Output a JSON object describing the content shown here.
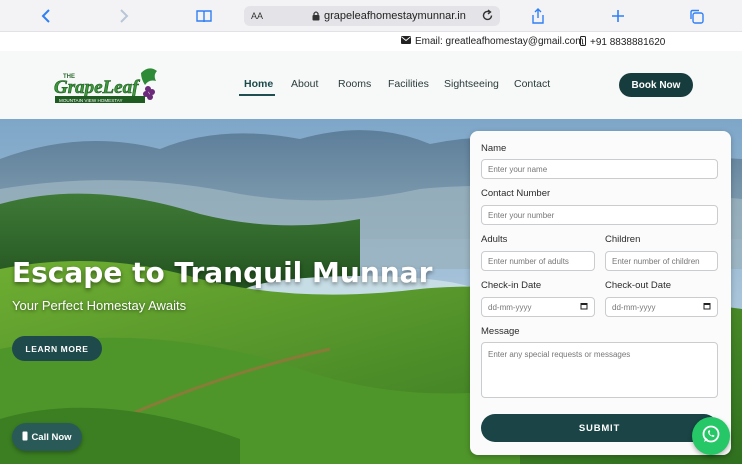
{
  "browser": {
    "url": "grapeleafhomestaymunnar.in",
    "aa_label": "AA",
    "icons": [
      "back-icon",
      "forward-icon",
      "bookmarks-icon",
      "lock-icon",
      "reload-icon",
      "share-icon",
      "new-tab-icon",
      "tabs-icon"
    ]
  },
  "topbar": {
    "email": "Email: greatleafhomestay@gmail.com",
    "phone": "+91 8838881620"
  },
  "logo": {
    "prefix": "THE",
    "name": "GrapeLeaf",
    "tagline": "MOUNTAIN VIEW HOMESTAY"
  },
  "nav": {
    "items": [
      "Home",
      "About",
      "Rooms",
      "Facilities",
      "Sightseeing",
      "Contact"
    ],
    "active": "Home",
    "book_label": "Book Now"
  },
  "hero": {
    "title": "Escape to Tranquil Munnar",
    "subtitle": "Your Perfect Homestay Awaits",
    "learn_more": "LEARN MORE",
    "call_now": "Call Now"
  },
  "form": {
    "name_label": "Name",
    "name_placeholder": "Enter your name",
    "contact_label": "Contact Number",
    "contact_placeholder": "Enter your number",
    "adults_label": "Adults",
    "adults_placeholder": "Enter number of adults",
    "children_label": "Children",
    "children_placeholder": "Enter number of children",
    "checkin_label": "Check-in Date",
    "checkin_placeholder": "dd-mm-yyyy",
    "checkout_label": "Check-out Date",
    "checkout_placeholder": "dd-mm-yyyy",
    "message_label": "Message",
    "message_placeholder": "Enter any special requests or messages",
    "submit_label": "SUBMIT"
  },
  "colors": {
    "primary": "#173c3d",
    "whatsapp": "#25c766"
  }
}
